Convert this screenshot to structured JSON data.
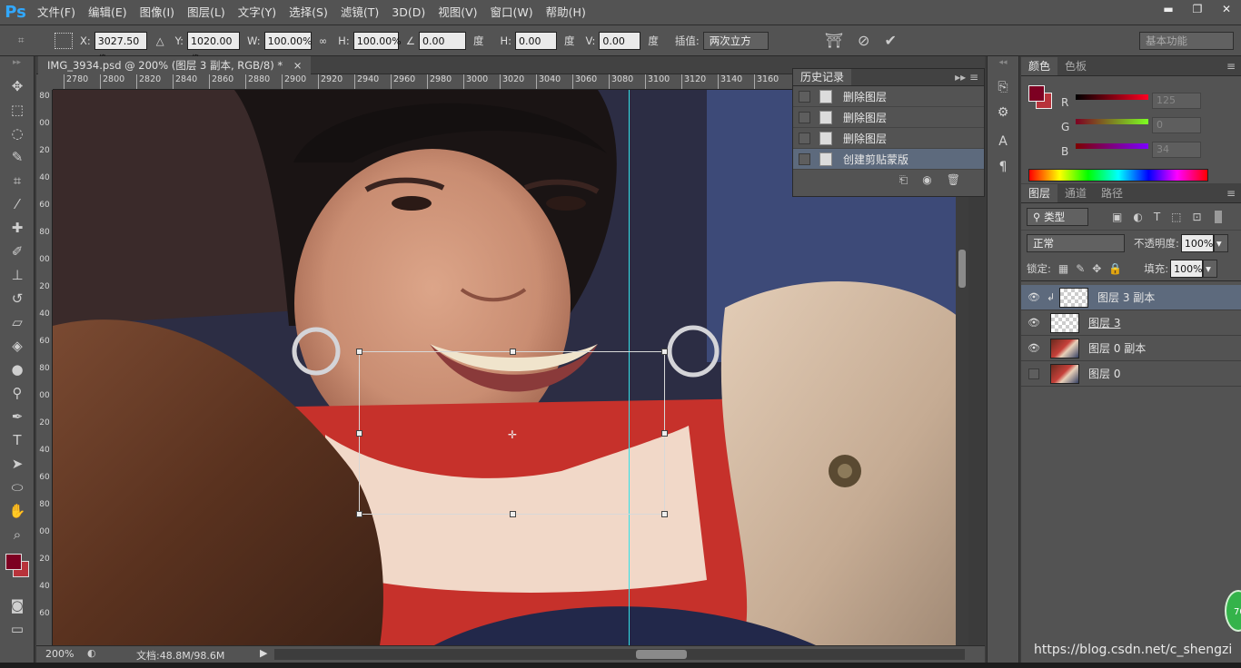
{
  "app": {
    "logo": "Ps"
  },
  "menu": [
    "文件(F)",
    "编辑(E)",
    "图像(I)",
    "图层(L)",
    "文字(Y)",
    "选择(S)",
    "滤镜(T)",
    "3D(D)",
    "视图(V)",
    "窗口(W)",
    "帮助(H)"
  ],
  "window_controls": {
    "minimize": "▬",
    "restore": "❐",
    "close": "✕"
  },
  "options": {
    "x_label": "X:",
    "x_value": "3027.50 像",
    "y_label": "Y:",
    "y_value": "1020.00 像",
    "w_label": "W:",
    "w_value": "100.00%",
    "h_label": "H:",
    "h_value": "100.00%",
    "angle_value": "0.00",
    "angle_unit": "度",
    "hskew_label": "H:",
    "hskew_value": "0.00",
    "hskew_unit": "度",
    "vskew_label": "V:",
    "vskew_value": "0.00",
    "vskew_unit": "度",
    "interp_label": "插值:",
    "interp_value": "两次立方",
    "workspace": "基本功能"
  },
  "document": {
    "tab_title": "IMG_3934.psd @ 200% (图层 3 副本, RGB/8) *",
    "close": "×"
  },
  "ruler": {
    "h_ticks": [
      "2780",
      "2800",
      "2820",
      "2840",
      "2860",
      "2880",
      "2900",
      "2920",
      "2940",
      "2960",
      "2980",
      "3000",
      "3020",
      "3040",
      "3060",
      "3080",
      "3100",
      "3120",
      "3140",
      "3160"
    ],
    "v_ticks": [
      "80",
      "00",
      "20",
      "40",
      "60",
      "80",
      "00",
      "20",
      "40",
      "60",
      "80",
      "00",
      "20",
      "40",
      "60",
      "80",
      "00",
      "20",
      "40",
      "60"
    ]
  },
  "status": {
    "zoom": "200%",
    "doc": "文档:48.8M/98.6M"
  },
  "history": {
    "tab": "历史记录",
    "items": [
      {
        "label": "删除图层",
        "selected": false
      },
      {
        "label": "删除图层",
        "selected": false
      },
      {
        "label": "删除图层",
        "selected": false
      },
      {
        "label": "创建剪贴蒙版",
        "selected": true
      }
    ]
  },
  "color_panel": {
    "tabs": [
      "颜色",
      "色板"
    ],
    "r_label": "R",
    "r_value": "125",
    "g_label": "G",
    "g_value": "0",
    "b_label": "B",
    "b_value": "34",
    "foreground": "#7d0022",
    "background": "#b8333b"
  },
  "layers_panel": {
    "tabs": [
      "图层",
      "通道",
      "路径"
    ],
    "filter": "类型",
    "blend_mode": "正常",
    "opacity_label": "不透明度:",
    "opacity_value": "100%",
    "lock_label": "锁定:",
    "fill_label": "填充:",
    "fill_value": "100%",
    "layers": [
      {
        "name": "图层 3 副本",
        "visible": true,
        "selected": true,
        "thumb": "transparent"
      },
      {
        "name": "图层 3",
        "visible": true,
        "selected": false,
        "thumb": "transparent"
      },
      {
        "name": "图层 0 副本",
        "visible": true,
        "selected": false,
        "thumb": "photo"
      },
      {
        "name": "图层 0",
        "visible": false,
        "selected": false,
        "thumb": "photo"
      }
    ]
  },
  "watermark": "https://blog.csdn.net/c_shengzi",
  "badge": "70"
}
